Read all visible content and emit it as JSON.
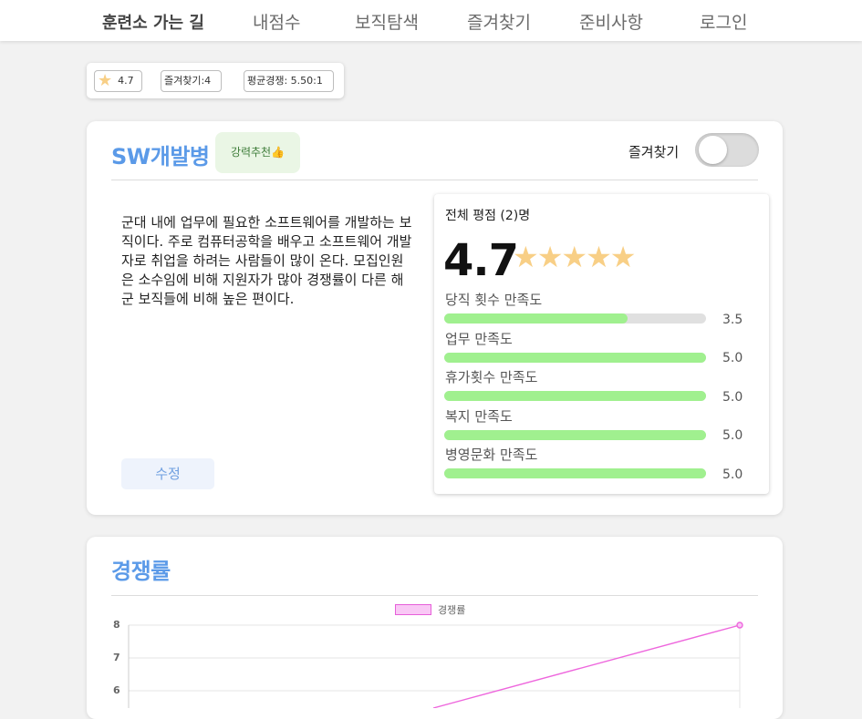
{
  "nav": {
    "brand": "훈련소 가는 길",
    "items": [
      "내점수",
      "보직탐색",
      "즐겨찾기",
      "준비사항",
      "로그인"
    ]
  },
  "stats": {
    "rating": "4.7",
    "favorites": "즐겨찾기:4",
    "competition": "평균경쟁: 5.50:1"
  },
  "job": {
    "title": "SW개발병",
    "badge": "강력추천👍",
    "favorite_label": "즐겨찾기",
    "favorite_on": false,
    "description": "군대 내에 업무에 필요한 소프트웨어를 개발하는 보직이다. 주로 컴퓨터공학을 배우고 소프트웨어 개발자로 취업을 하려는 사람들이 많이 온다. 모집인원은 소수임에 비해 지원자가 많아 경쟁률이 다른 해군 보직들에 비해 높은 편이다.",
    "edit_label": "수정"
  },
  "rating": {
    "header": "전체 평점 (2)명",
    "score": "4.7",
    "stars": "★★★★★",
    "star_color": "#f8cf86",
    "bar_color": "#a0f08f",
    "metrics": [
      {
        "label": "당직 횟수 만족도",
        "value": "3.5",
        "fraction": 0.7
      },
      {
        "label": "업무 만족도",
        "value": "5.0",
        "fraction": 1.0
      },
      {
        "label": "휴가횟수 만족도",
        "value": "5.0",
        "fraction": 1.0
      },
      {
        "label": "복지 만족도",
        "value": "5.0",
        "fraction": 1.0
      },
      {
        "label": "병영문화 만족도",
        "value": "5.0",
        "fraction": 1.0
      }
    ]
  },
  "competition": {
    "title": "경쟁률"
  },
  "chart_data": {
    "type": "line",
    "series": [
      {
        "name": "경쟁률",
        "color": "#ee66dd"
      }
    ],
    "yticks": [
      "8",
      "7",
      "6"
    ],
    "visible_points": [
      {
        "y": 8
      }
    ]
  }
}
